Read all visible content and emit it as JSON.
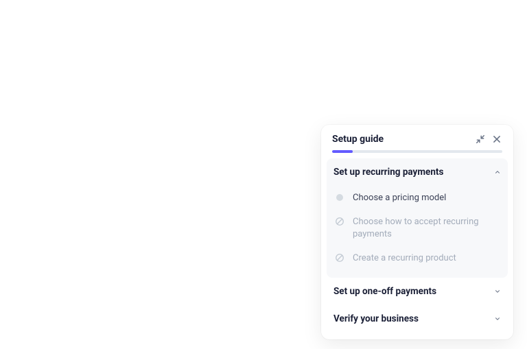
{
  "panel": {
    "title": "Setup guide",
    "progress_percent": 12
  },
  "sections": [
    {
      "title": "Set up recurring payments",
      "expanded": true,
      "steps": [
        {
          "label": "Choose a pricing model",
          "state": "active"
        },
        {
          "label": "Choose how to accept recurring payments",
          "state": "locked"
        },
        {
          "label": "Create a recurring product",
          "state": "locked"
        }
      ]
    },
    {
      "title": "Set up one-off payments",
      "expanded": false
    },
    {
      "title": "Verify your business",
      "expanded": false
    }
  ]
}
